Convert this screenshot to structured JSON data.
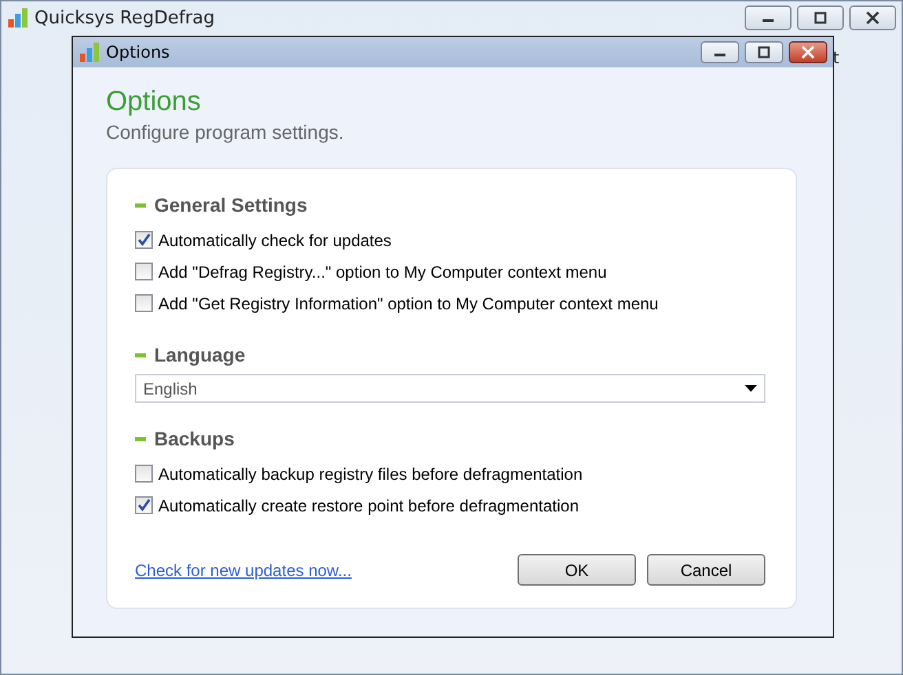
{
  "main_window": {
    "title": "Quicksys RegDefrag",
    "hidden_text": "t"
  },
  "dialog": {
    "title": "Options",
    "heading": "Options",
    "subtitle": "Configure program settings."
  },
  "sections": [
    {
      "kind": "checks",
      "title": "General Settings",
      "options": [
        {
          "label": "Automatically check for updates",
          "checked": true
        },
        {
          "label": "Add \"Defrag Registry...\" option to My Computer context menu",
          "checked": false
        },
        {
          "label": "Add \"Get Registry Information\" option to My Computer context menu",
          "checked": false
        }
      ]
    },
    {
      "kind": "select",
      "title": "Language",
      "value": "English"
    },
    {
      "kind": "checks",
      "title": "Backups",
      "options": [
        {
          "label": "Automatically backup registry files before defragmentation",
          "checked": false
        },
        {
          "label": "Automatically create restore point before defragmentation",
          "checked": true
        }
      ]
    }
  ],
  "link": "Check for new updates now...",
  "buttons": [
    "OK",
    "Cancel"
  ]
}
